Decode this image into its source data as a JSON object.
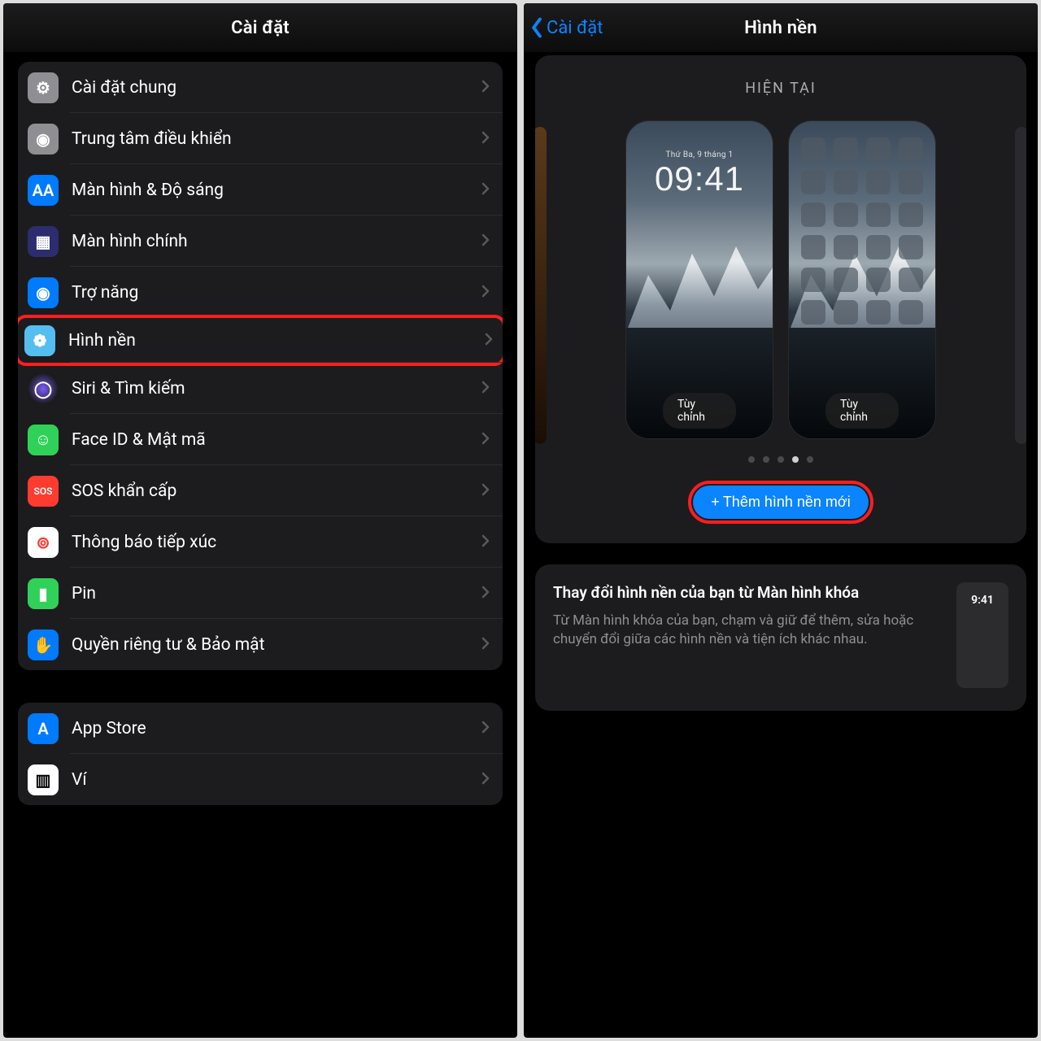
{
  "left": {
    "title": "Cài đặt",
    "group1": [
      {
        "label": "Cài đặt chung",
        "icon": "gear-icon",
        "cls": "ic-gray",
        "glyph": "⚙"
      },
      {
        "label": "Trung tâm điều khiển",
        "icon": "control-center-icon",
        "cls": "ic-gray2",
        "glyph": "◉"
      },
      {
        "label": "Màn hình & Độ sáng",
        "icon": "display-brightness-icon",
        "cls": "ic-blue",
        "glyph": "AA"
      },
      {
        "label": "Màn hình chính",
        "icon": "home-screen-icon",
        "cls": "ic-dark",
        "glyph": "▦"
      },
      {
        "label": "Trợ năng",
        "icon": "accessibility-icon",
        "cls": "ic-blue",
        "glyph": "◉"
      },
      {
        "label": "Hình nền",
        "icon": "wallpaper-icon",
        "cls": "ic-cyan",
        "glyph": "❁",
        "highlight": true
      },
      {
        "label": "Siri & Tìm kiếm",
        "icon": "siri-icon",
        "cls": "ic-siri",
        "glyph": "◯"
      },
      {
        "label": "Face ID & Mật mã",
        "icon": "faceid-icon",
        "cls": "ic-green",
        "glyph": "☺"
      },
      {
        "label": "SOS khẩn cấp",
        "icon": "sos-icon",
        "cls": "ic-red",
        "glyph": "SOS"
      },
      {
        "label": "Thông báo tiếp xúc",
        "icon": "exposure-icon",
        "cls": "ic-white",
        "glyph": "⊚"
      },
      {
        "label": "Pin",
        "icon": "battery-icon",
        "cls": "ic-green",
        "glyph": "▮"
      },
      {
        "label": "Quyền riêng tư & Bảo mật",
        "icon": "privacy-icon",
        "cls": "ic-hand",
        "glyph": "✋"
      }
    ],
    "group2": [
      {
        "label": "App Store",
        "icon": "appstore-icon",
        "cls": "ic-blue",
        "glyph": "A"
      },
      {
        "label": "Ví",
        "icon": "wallet-icon",
        "cls": "ic-wallet",
        "glyph": "▥"
      }
    ]
  },
  "right": {
    "back": "Cài đặt",
    "title": "Hình nền",
    "current": "HIỆN TẠI",
    "lock_date": "Thứ Ba, 9 tháng 1",
    "lock_time": "09:41",
    "customize": "Tùy chỉnh",
    "add": "Thêm hình nền mới",
    "info_title": "Thay đổi hình nền của bạn từ Màn hình khóa",
    "info_desc": "Từ Màn hình khóa của bạn, chạm và giữ để thêm, sửa hoặc chuyển đổi giữa các hình nền và tiện ích khác nhau.",
    "mini_time": "9:41",
    "dots_active": 3,
    "dots_total": 5
  }
}
